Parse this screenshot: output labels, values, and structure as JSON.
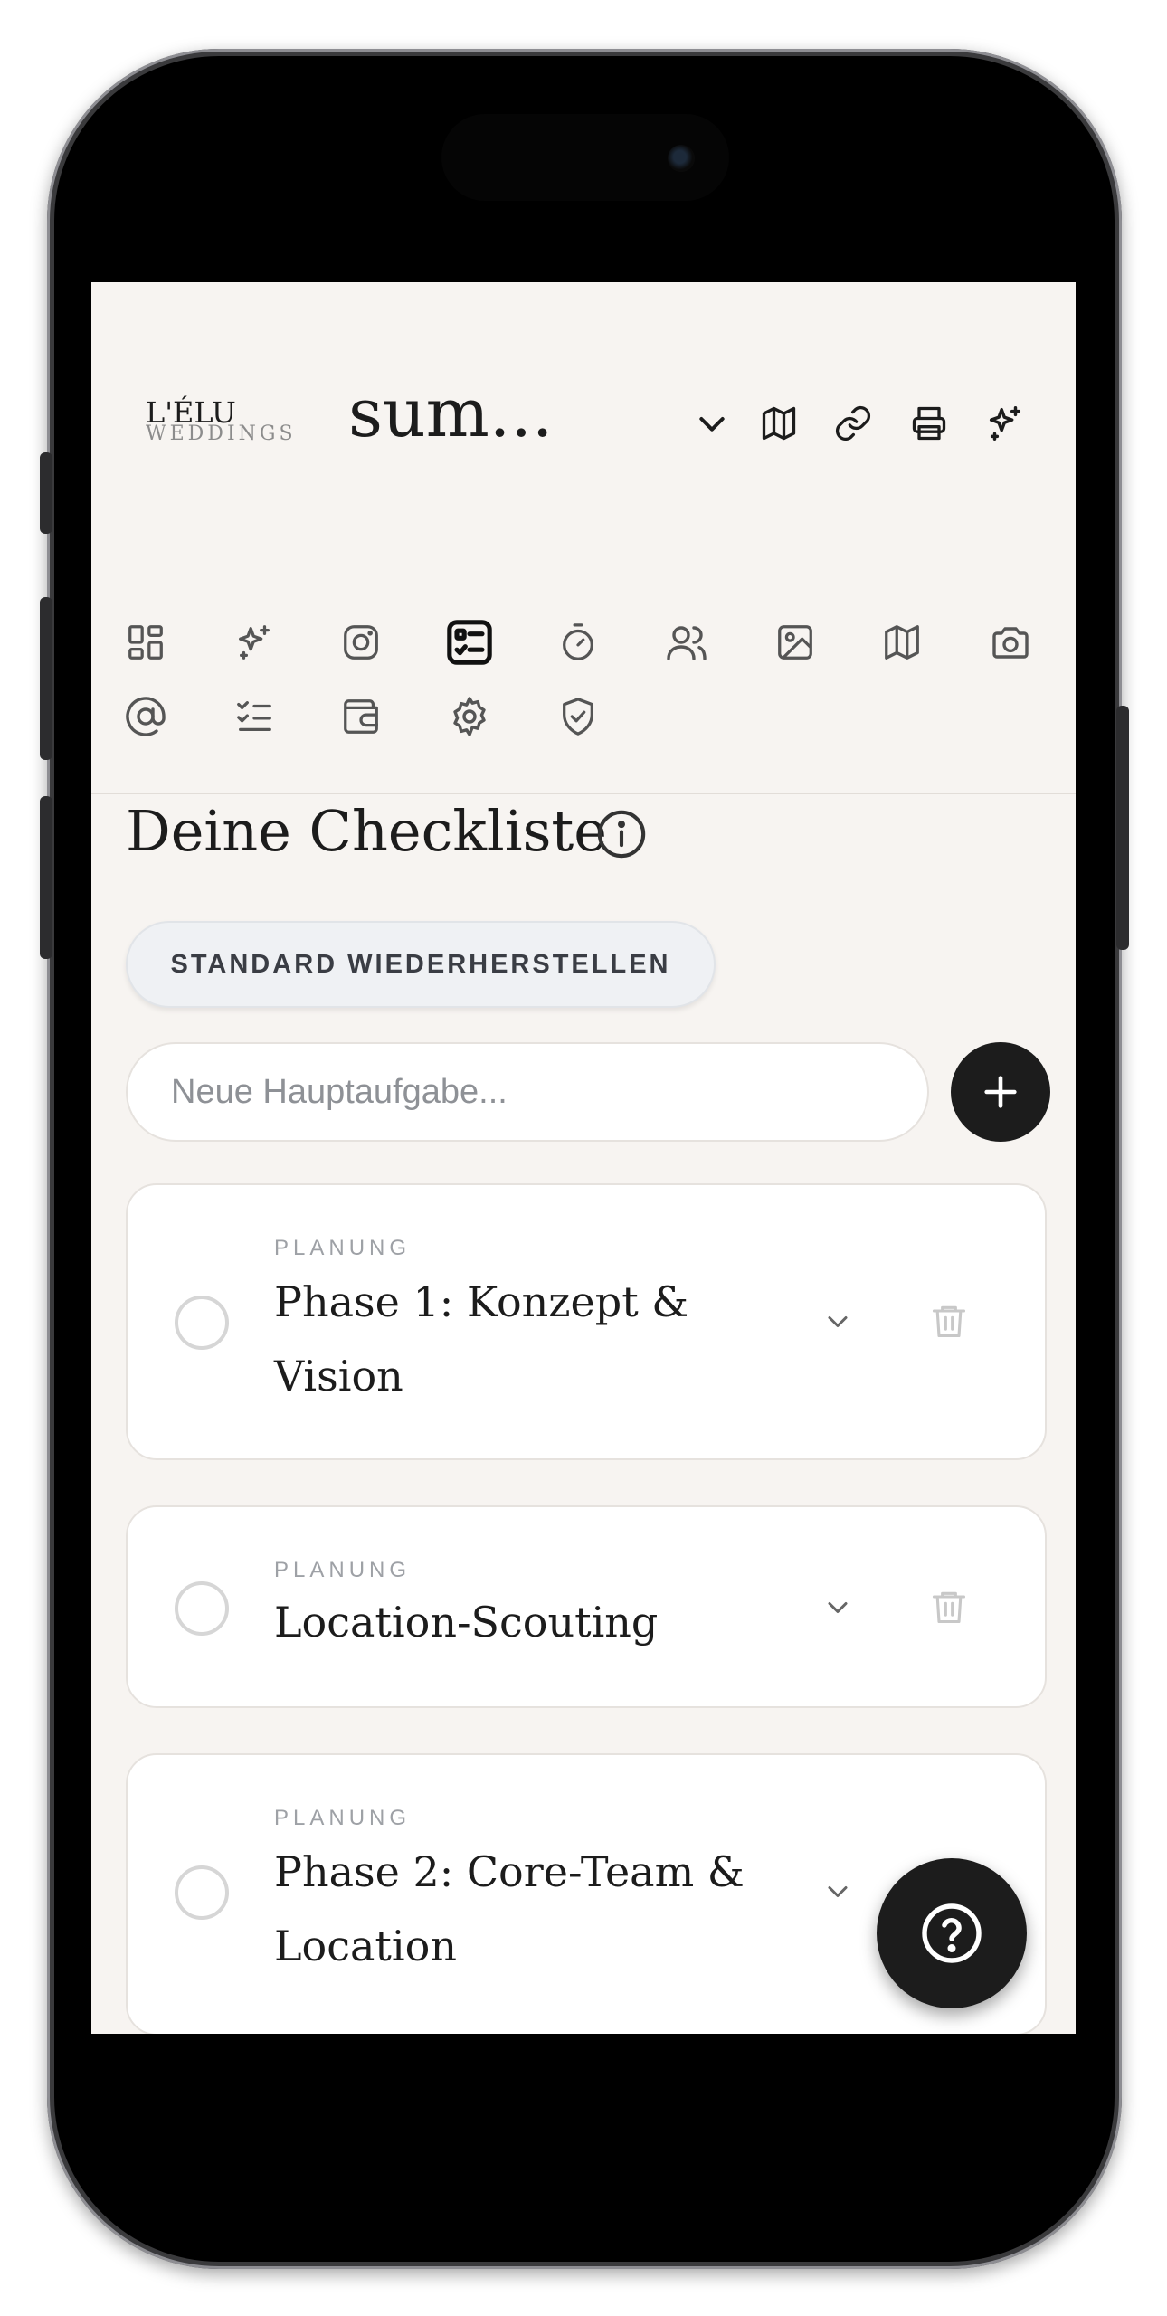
{
  "header": {
    "logo_main": "L'ÉLU",
    "logo_sub": "WEDDINGS",
    "event_title": "sum...",
    "icons": [
      "chevron-down-icon",
      "map-icon",
      "link-icon",
      "printer-icon",
      "sparkles-icon"
    ]
  },
  "nav": {
    "row1": [
      "grid-icon",
      "sparkles-icon",
      "instagram-icon",
      "checklist-icon",
      "timer-icon",
      "guests-icon",
      "image-icon",
      "map-icon",
      "camera-icon"
    ],
    "row2": [
      "at-icon",
      "list-check-icon",
      "wallet-icon",
      "settings-icon",
      "shield-check-icon"
    ],
    "active": "checklist-icon"
  },
  "checklist": {
    "title": "Deine Checkliste",
    "restore_label": "STANDARD WIEDERHERSTELLEN",
    "new_task_placeholder": "Neue Hauptaufgabe..."
  },
  "tasks": [
    {
      "category": "PLANUNG",
      "title": "Phase 1: Konzept & Vision",
      "done": false
    },
    {
      "category": "PLANUNG",
      "title": "Location-Scouting",
      "done": false
    },
    {
      "category": "PLANUNG",
      "title": "Phase 2: Core-Team & Location",
      "done": false
    }
  ],
  "colors": {
    "background": "#f7f4f1",
    "accent_dark": "#1c1c1c",
    "muted": "#9ea1a6"
  }
}
